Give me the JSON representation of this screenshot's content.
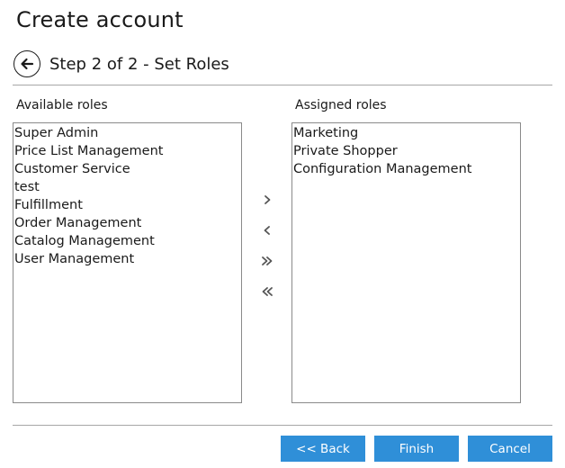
{
  "header": {
    "title": "Create account",
    "step_title": "Step 2 of 2 - Set Roles",
    "back_icon": "arrow-left-icon"
  },
  "available": {
    "label": "Available roles",
    "items": [
      "Super Admin",
      "Price List Management",
      "Customer Service",
      "test",
      "Fulfillment",
      "Order Management",
      "Catalog Management",
      "User Management"
    ]
  },
  "assigned": {
    "label": "Assigned roles",
    "items": [
      "Marketing",
      "Private Shopper",
      "Configuration Management"
    ]
  },
  "move_buttons": {
    "add_icon": "chevron-right-icon",
    "remove_icon": "chevron-left-icon",
    "add_all_icon": "double-chevron-right-icon",
    "remove_all_icon": "double-chevron-left-icon"
  },
  "footer": {
    "back_label": "<< Back",
    "finish_label": "Finish",
    "cancel_label": "Cancel"
  },
  "colors": {
    "button_bg": "#2f8fd8",
    "button_text": "#ffffff"
  }
}
